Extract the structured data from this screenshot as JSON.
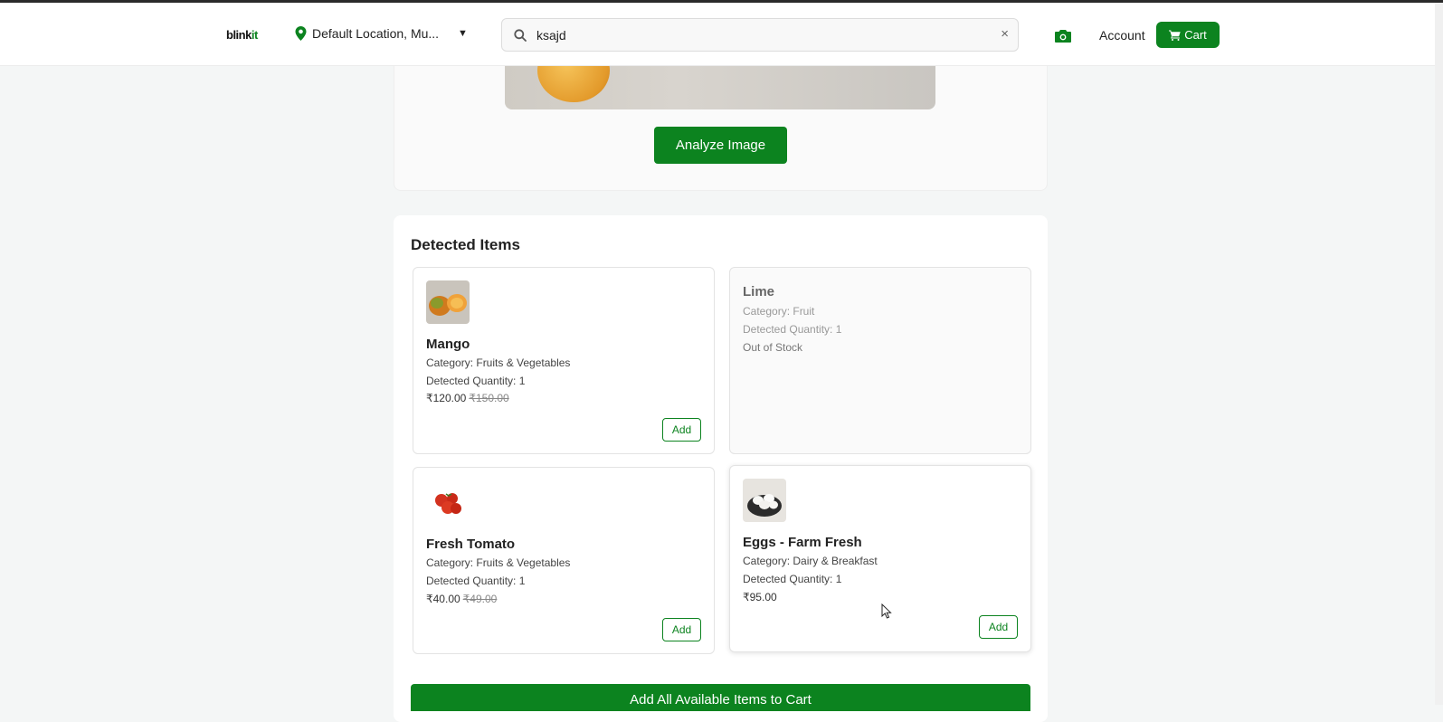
{
  "header": {
    "logo_main": "blink",
    "logo_accent": "it",
    "location_label": "Default Location, Mu...",
    "location_chevron": "▼",
    "search_value": "ksajd",
    "clear_glyph": "×",
    "account_label": "Account",
    "cart_label": "Cart"
  },
  "upload": {
    "analyze_label": "Analyze Image"
  },
  "detected": {
    "title": "Detected Items",
    "items": [
      {
        "name": "Mango",
        "category": "Category: Fruits & Vegetables",
        "quantity": "Detected Quantity: 1",
        "price": "₹120.00",
        "mrp": "₹150.00",
        "add_label": "Add",
        "icon": "mango-thumbnail"
      },
      {
        "name": "Lime",
        "category": "Category: Fruit",
        "quantity": "Detected Quantity: 1",
        "stock": "Out of Stock"
      },
      {
        "name": "Fresh Tomato",
        "category": "Category: Fruits & Vegetables",
        "quantity": "Detected Quantity: 1",
        "price": "₹40.00",
        "mrp": "₹49.00",
        "add_label": "Add",
        "icon": "tomato-thumbnail"
      },
      {
        "name": "Eggs - Farm Fresh",
        "category": "Category: Dairy & Breakfast",
        "quantity": "Detected Quantity: 1",
        "price": "₹95.00",
        "add_label": "Add",
        "icon": "eggs-thumbnail"
      }
    ],
    "add_all_label": "Add All Available Items to Cart"
  },
  "colors": {
    "brand_green": "#0c831f",
    "page_bg": "#f4f6f6"
  }
}
